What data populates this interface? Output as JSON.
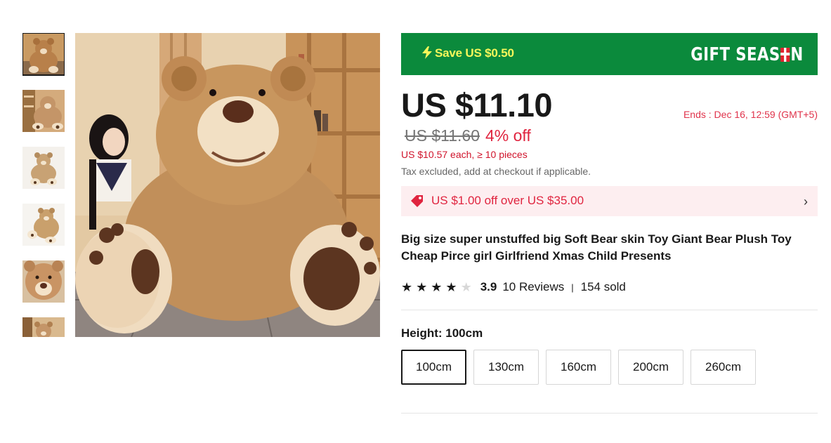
{
  "gallery": {
    "thumbnails": [
      {
        "icon": "teddy-bear-thumbnail",
        "active": true
      },
      {
        "icon": "teddy-bear-thumbnail",
        "active": false
      },
      {
        "icon": "teddy-bear-thumbnail",
        "active": false
      },
      {
        "icon": "teddy-bear-thumbnail",
        "active": false
      },
      {
        "icon": "teddy-bear-face-thumbnail",
        "active": false
      },
      {
        "icon": "teddy-bear-thumbnail",
        "active": false
      }
    ],
    "main_image": "giant-teddy-bear-photo"
  },
  "banner": {
    "save_label": "Save US $0.50",
    "season_part1": "GIFT SEAS",
    "season_part2": "N",
    "bg_color": "#0b8a3c"
  },
  "pricing": {
    "price": "US $11.10",
    "ends": "Ends :  Dec 16, 12:59 (GMT+5)",
    "old_price": "US $11.60",
    "discount": "4% off",
    "bulk": "US $10.57 each, ≥ 10 pieces",
    "tax_note": "Tax excluded, add at checkout if applicable."
  },
  "coupon": {
    "text": "US $1.00 off over US $35.00",
    "chevron": "›"
  },
  "product": {
    "title": "Big size super unstuffed big Soft Bear skin Toy Giant Bear Plush Toy Cheap Pirce girl Girlfriend Xmas Child Presents"
  },
  "rating": {
    "stars": 4,
    "max_stars": 5,
    "score": "3.9",
    "reviews": "10 Reviews",
    "separator": "|",
    "sold": "154 sold"
  },
  "variant": {
    "label": "Height: 100cm",
    "options": [
      "100cm",
      "130cm",
      "160cm",
      "200cm",
      "260cm"
    ],
    "selected": "100cm"
  },
  "colors": {
    "accent_red": "#e0243f",
    "banner_green": "#0b8a3c",
    "save_yellow": "#f7f75a"
  }
}
